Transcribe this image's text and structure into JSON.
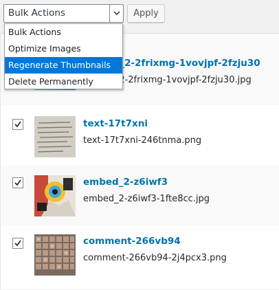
{
  "toolbar": {
    "bulk_select_value": "Bulk Actions",
    "apply_label": "Apply"
  },
  "dropdown": {
    "options": [
      "Bulk Actions",
      "Optimize Images",
      "Regenerate Thumbnails",
      "Delete Permanently"
    ],
    "highlighted": "Regenerate Thumbnails"
  },
  "rows": [
    {
      "title": "header_2-2frixmg-1vovjpf-2fzju30",
      "file": "header_2-2frixmg-1vovjpf-2fzju30.jpg",
      "checked": true
    },
    {
      "title": "text-17t7xni",
      "file": "text-17t7xni-246tnma.png",
      "checked": true
    },
    {
      "title": "embed_2-z6iwf3",
      "file": "embed_2-z6iwf3-1fte8cc.jpg",
      "checked": true
    },
    {
      "title": "comment-266vb94",
      "file": "comment-266vb94-2j4pcx3.png",
      "checked": true
    }
  ],
  "colors": {
    "link": "#0073aa",
    "highlight": "#0078d7"
  },
  "icons": [
    "chevron-down-icon",
    "checkmark-icon"
  ]
}
